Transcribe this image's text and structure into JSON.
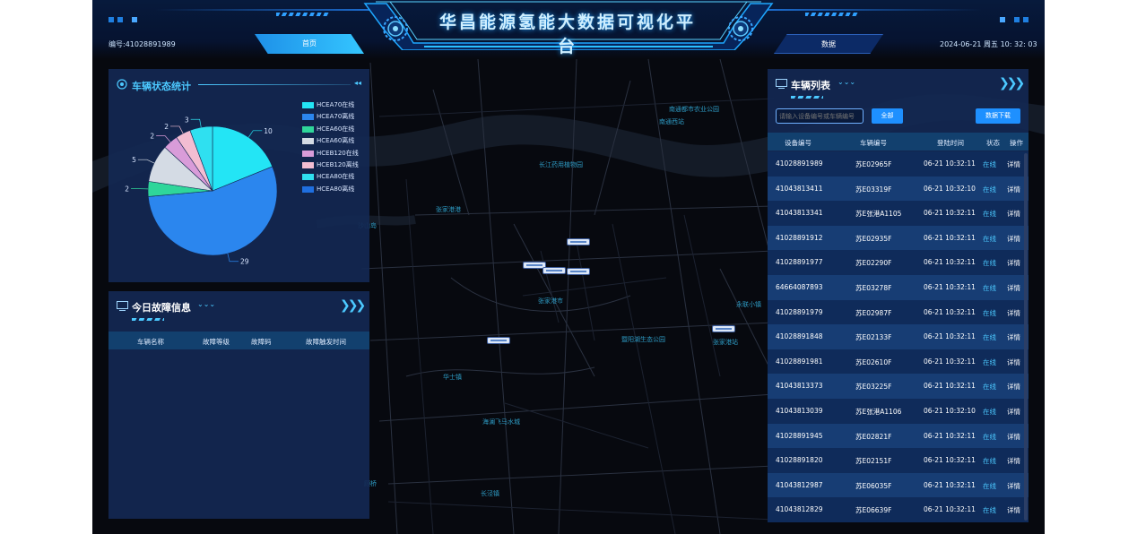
{
  "header": {
    "title": "华昌能源氢能大数据可视化平台",
    "device_no": "编号:41028891989",
    "datetime": "2024-06-21 周五 10: 32: 03",
    "nav": {
      "home": "首页",
      "data": "数据"
    }
  },
  "status_panel": {
    "title": "车辆状态统计",
    "chart_data": {
      "type": "pie",
      "categories": [
        "HCEA70在线",
        "HCEA70离线",
        "HCEA60在线",
        "HCEA60离线",
        "HCEB120在线",
        "HCEB120离线",
        "HCEA80在线",
        "HCEA80离线"
      ],
      "values": [
        10,
        29,
        2,
        5,
        2,
        2,
        3,
        0
      ],
      "colors": [
        "#23e5f5",
        "#2b86ee",
        "#2fd69a",
        "#d4dbe4",
        "#d99cd9",
        "#f3bdd2",
        "#2fe0f0",
        "#1f6fe0"
      ]
    }
  },
  "fault_panel": {
    "title": "今日故障信息",
    "columns": [
      "车辆名称",
      "故障等级",
      "故障码",
      "故障触发时间"
    ]
  },
  "vehicle_panel": {
    "title": "车辆列表",
    "search_placeholder": "请输入设备编号或车辆编号",
    "all_button": "全部",
    "download_button": "数据下载",
    "columns": [
      "设备编号",
      "车辆编号",
      "登陆时间",
      "状态",
      "操作"
    ],
    "rows": [
      {
        "device": "41028891989",
        "plate": "苏E02965F",
        "time": "06-21 10:32:11",
        "status": "在线",
        "action": "详情"
      },
      {
        "device": "41043813411",
        "plate": "苏E03319F",
        "time": "06-21 10:32:10",
        "status": "在线",
        "action": "详情"
      },
      {
        "device": "41043813341",
        "plate": "苏E张港A1105",
        "time": "06-21 10:32:11",
        "status": "在线",
        "action": "详情"
      },
      {
        "device": "41028891912",
        "plate": "苏E02935F",
        "time": "06-21 10:32:11",
        "status": "在线",
        "action": "详情"
      },
      {
        "device": "41028891977",
        "plate": "苏E02290F",
        "time": "06-21 10:32:11",
        "status": "在线",
        "action": "详情"
      },
      {
        "device": "64664087893",
        "plate": "苏E03278F",
        "time": "06-21 10:32:11",
        "status": "在线",
        "action": "详情"
      },
      {
        "device": "41028891979",
        "plate": "苏E02987F",
        "time": "06-21 10:32:11",
        "status": "在线",
        "action": "详情"
      },
      {
        "device": "41028891848",
        "plate": "苏E02133F",
        "time": "06-21 10:32:11",
        "status": "在线",
        "action": "详情"
      },
      {
        "device": "41028891981",
        "plate": "苏E02610F",
        "time": "06-21 10:32:11",
        "status": "在线",
        "action": "详情"
      },
      {
        "device": "41043813373",
        "plate": "苏E03225F",
        "time": "06-21 10:32:11",
        "status": "在线",
        "action": "详情"
      },
      {
        "device": "41043813039",
        "plate": "苏E张港A1106",
        "time": "06-21 10:32:10",
        "status": "在线",
        "action": "详情"
      },
      {
        "device": "41028891945",
        "plate": "苏E02821F",
        "time": "06-21 10:32:11",
        "status": "在线",
        "action": "详情"
      },
      {
        "device": "41028891820",
        "plate": "苏E02151F",
        "time": "06-21 10:32:11",
        "status": "在线",
        "action": "详情"
      },
      {
        "device": "41043812987",
        "plate": "苏E06035F",
        "time": "06-21 10:32:11",
        "status": "在线",
        "action": "详情"
      },
      {
        "device": "41043812829",
        "plate": "苏E06639F",
        "time": "06-21 10:32:11",
        "status": "在线",
        "action": "详情"
      }
    ]
  },
  "map_labels": [
    "南通都市农业公园",
    "南通西站",
    "长江药用植物园",
    "张家港港",
    "沙山岛",
    "张家港市",
    "永联小镇",
    "暨阳湖生态公园",
    "张家港站",
    "华士镇",
    "海澜飞马水城",
    "长泾镇",
    "顾桥"
  ]
}
